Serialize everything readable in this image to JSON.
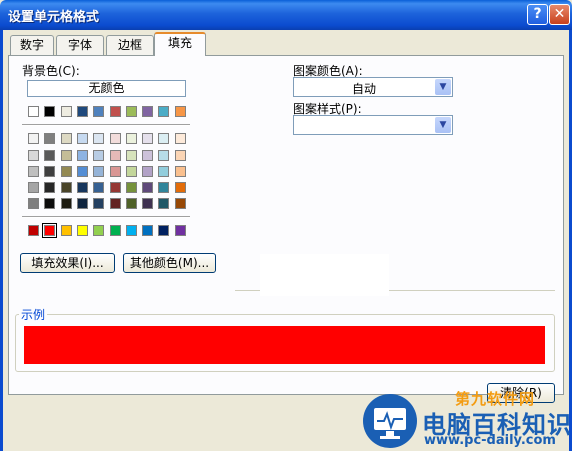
{
  "window": {
    "title": "设置单元格格式",
    "help": "?",
    "close": "✕"
  },
  "tabs": [
    {
      "label": "数字",
      "active": false
    },
    {
      "label": "字体",
      "active": false
    },
    {
      "label": "边框",
      "active": false
    },
    {
      "label": "填充",
      "active": true
    }
  ],
  "fill": {
    "background_label": "背景色(C):",
    "no_color": "无颜色",
    "selected_color": "#ff0000",
    "theme_row": [
      "#ffffff",
      "#000000",
      "#eeece1",
      "#1f497d",
      "#4f81bd",
      "#c0504d",
      "#9bbb59",
      "#8064a2",
      "#4bacc6",
      "#f79646"
    ],
    "tint_rows": [
      [
        "#f2f2f2",
        "#7f7f7f",
        "#ddd9c3",
        "#c6d9f0",
        "#dbe5f1",
        "#f2dcdb",
        "#ebf1dd",
        "#e5e0ec",
        "#dbeef3",
        "#fdeada"
      ],
      [
        "#d8d8d8",
        "#595959",
        "#c4bd97",
        "#8db3e2",
        "#b8cce4",
        "#e5b9b7",
        "#d7e3bc",
        "#ccc1d9",
        "#b7dde8",
        "#fbd5b5"
      ],
      [
        "#bfbfbf",
        "#3f3f3f",
        "#938953",
        "#548dd4",
        "#95b3d7",
        "#d99694",
        "#c3d69b",
        "#b2a2c7",
        "#92cddc",
        "#fac08f"
      ],
      [
        "#a5a5a5",
        "#262626",
        "#494429",
        "#17365d",
        "#366092",
        "#953734",
        "#76923c",
        "#5f497a",
        "#31859b",
        "#e36c09"
      ],
      [
        "#7f7f7f",
        "#0c0c0c",
        "#1d1b10",
        "#0f243e",
        "#244061",
        "#632423",
        "#4f6128",
        "#3f3151",
        "#205867",
        "#974806"
      ]
    ],
    "standard_row": [
      "#c00000",
      "#ff0000",
      "#ffc000",
      "#ffff00",
      "#92d050",
      "#00b050",
      "#00b0f0",
      "#0070c0",
      "#002060",
      "#7030a0"
    ],
    "fill_effects_btn": "填充效果(I)...",
    "more_colors_btn": "其他颜色(M)...",
    "pattern_color_label": "图案颜色(A):",
    "pattern_color_value": "自动",
    "pattern_style_label": "图案样式(P):",
    "pattern_style_value": "",
    "sample_label": "示例",
    "clear_btn": "清除(R)"
  },
  "watermark": {
    "brand_top": "第九软件网",
    "brand": "电脑百科知识",
    "url": "www.pc-daily.com"
  },
  "colors": {
    "titlebar": "#0b4bcf",
    "accent_tab": "#e68b2c",
    "sample_red": "#ff0000",
    "watermark_blue": "#1a5fb4",
    "watermark_orange": "#f39c12"
  }
}
